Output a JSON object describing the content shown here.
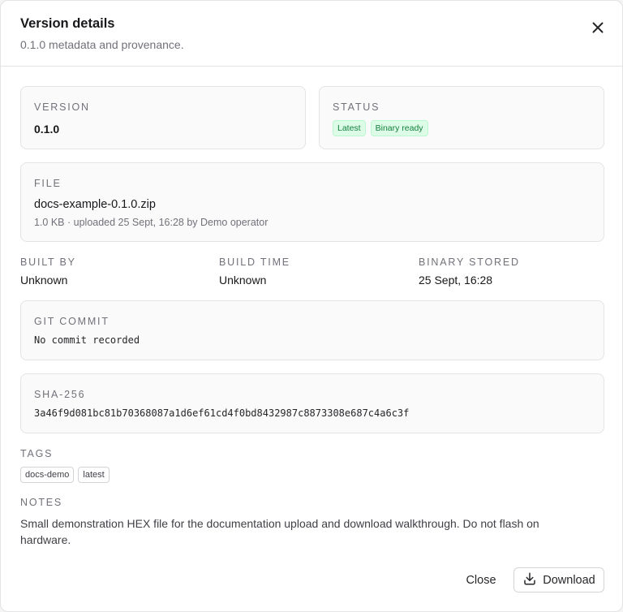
{
  "dialog": {
    "title": "Version details",
    "subtitle": "0.1.0 metadata and provenance."
  },
  "version": {
    "label": "VERSION",
    "value": "0.1.0"
  },
  "status": {
    "label": "STATUS",
    "badges": [
      "Latest",
      "Binary ready"
    ]
  },
  "file": {
    "label": "FILE",
    "name": "docs-example-0.1.0.zip",
    "meta": "1.0 KB · uploaded 25 Sept, 16:28 by Demo operator"
  },
  "built_by": {
    "label": "BUILT BY",
    "value": "Unknown"
  },
  "build_time": {
    "label": "BUILD TIME",
    "value": "Unknown"
  },
  "binary_stored": {
    "label": "BINARY STORED",
    "value": "25 Sept, 16:28"
  },
  "git_commit": {
    "label": "GIT COMMIT",
    "value": "No commit recorded"
  },
  "sha256": {
    "label": "SHA-256",
    "value": "3a46f9d081bc81b70368087a1d6ef61cd4f0bd8432987c8873308e687c4a6c3f"
  },
  "tags": {
    "label": "TAGS",
    "items": [
      "docs-demo",
      "latest"
    ]
  },
  "notes": {
    "label": "NOTES",
    "text": "Small demonstration HEX file for the documentation upload and download walkthrough. Do not flash on hardware."
  },
  "footer": {
    "close_label": "Close",
    "download_label": "Download"
  },
  "colors": {
    "badge_bg": "#dcfce7",
    "badge_text": "#15803d",
    "border": "#e4e4e7"
  }
}
